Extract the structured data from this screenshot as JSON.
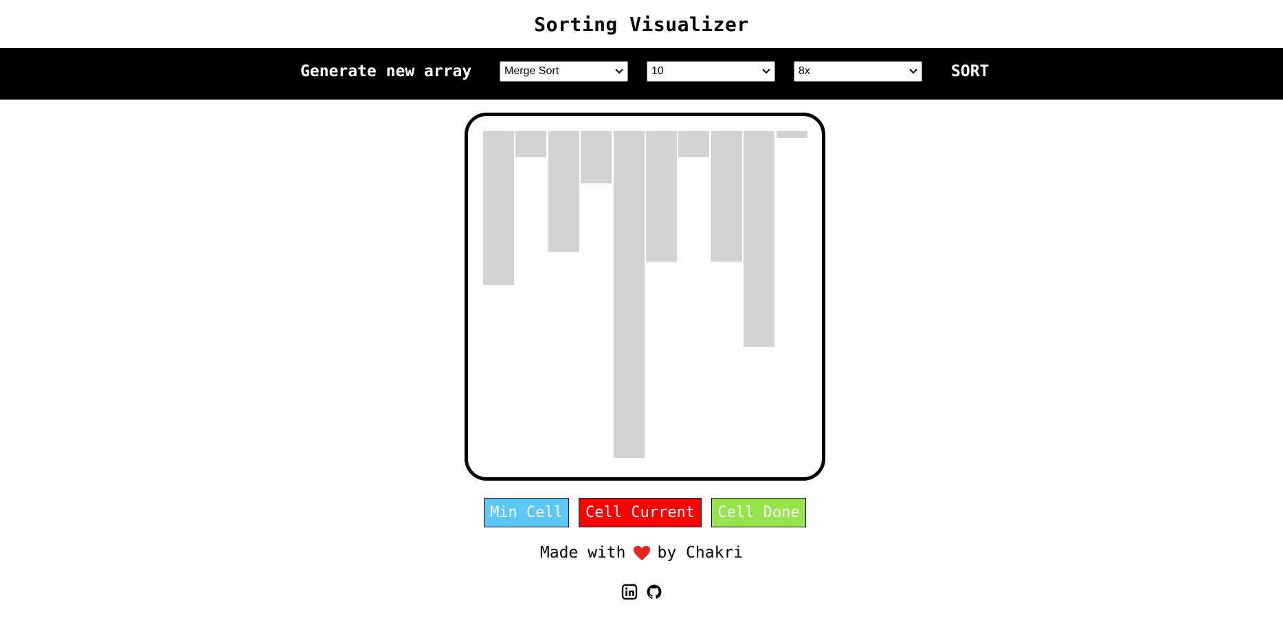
{
  "header": {
    "title": "Sorting Visualizer"
  },
  "toolbar": {
    "generate_label": "Generate new array",
    "algorithm_select": {
      "selected": "Merge Sort"
    },
    "size_select": {
      "selected": "10"
    },
    "speed_select": {
      "selected": "8x"
    },
    "sort_label": "SORT"
  },
  "visualizer": {
    "bar_color": "#d3d3d3",
    "bar_values": [
      47,
      8,
      37,
      16,
      100,
      40,
      8,
      40,
      66,
      2
    ]
  },
  "legend": {
    "items": [
      {
        "label": "Min Cell",
        "color": "#5bc8f5"
      },
      {
        "label": "Cell Current",
        "color": "#ff0000"
      },
      {
        "label": "Cell Done",
        "color": "#95e44c"
      }
    ]
  },
  "footer": {
    "made_with": "Made with",
    "by": "by Chakri",
    "heart_icon": "heart-icon",
    "heart_color": "#e8251d",
    "social": [
      "linkedin-icon",
      "github-icon"
    ]
  }
}
